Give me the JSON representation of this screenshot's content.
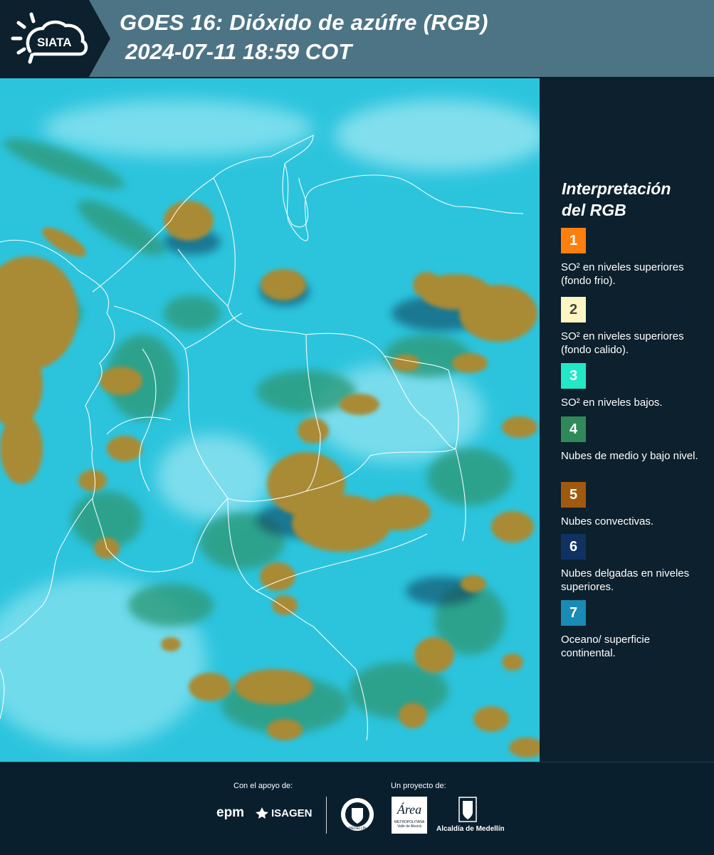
{
  "header": {
    "logo_text": "SIATA",
    "title_line1": "GOES 16: Dióxido de azúfre (RGB)",
    "title_line2": "2024-07-11 18:59 COT"
  },
  "legend": {
    "title_line1": "Interpretación",
    "title_line2": "del RGB",
    "items": [
      {
        "number": "1",
        "color": "#ff7f0e",
        "text": "SO² en niveles superiores (fondo frio)."
      },
      {
        "number": "2",
        "color": "#fdf6c3",
        "text": "SO² en niveles superiores (fondo calido)."
      },
      {
        "number": "3",
        "color": "#22e8c8",
        "text": "SO² en niveles bajos."
      },
      {
        "number": "4",
        "color": "#2f8a5a",
        "text": "Nubes de medio y bajo nivel."
      },
      {
        "number": "5",
        "color": "#a05a0f",
        "text": "Nubes convectivas."
      },
      {
        "number": "6",
        "color": "#0f3262",
        "text": "Nubes delgadas en niveles superiores."
      },
      {
        "number": "7",
        "color": "#1a8bb4",
        "text": "Oceano/ superficie continental."
      }
    ]
  },
  "footer": {
    "support_label": "Con el apoyo de:",
    "project_label": "Un proyecto de:",
    "epm_text": "epm",
    "isagen_text": "ISAGEN",
    "medellin_text": "MEDELLÍN",
    "area_text": "Área",
    "area_sub": "METROPOLITANA",
    "area_sub2": "Valle de Aburrá",
    "alcaldia_text": "Alcaldía de Medellín"
  }
}
